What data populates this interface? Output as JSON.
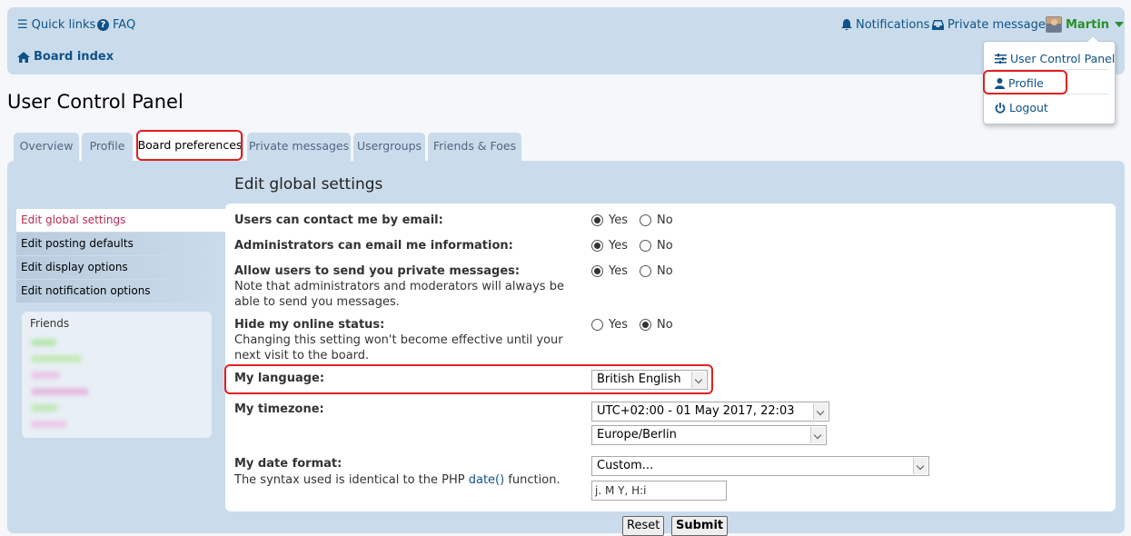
{
  "navbar": {
    "quick_links": "Quick links",
    "faq": "FAQ",
    "board_index": "Board index",
    "notifications": "Notifications",
    "private_messages": "Private messages",
    "username": "Martin"
  },
  "user_menu": {
    "items": [
      {
        "label": "User Control Panel",
        "icon": "sliders-icon"
      },
      {
        "label": "Profile",
        "icon": "user-icon"
      },
      {
        "label": "Logout",
        "icon": "power-icon"
      }
    ]
  },
  "page": {
    "title": "User Control Panel"
  },
  "tabs": [
    {
      "label": "Overview"
    },
    {
      "label": "Profile"
    },
    {
      "label": "Board preferences",
      "active": true
    },
    {
      "label": "Private messages"
    },
    {
      "label": "Usergroups"
    },
    {
      "label": "Friends & Foes"
    }
  ],
  "sidebar": {
    "items": [
      {
        "label": "Edit global settings",
        "active": true
      },
      {
        "label": "Edit posting defaults"
      },
      {
        "label": "Edit display options"
      },
      {
        "label": "Edit notification options"
      }
    ],
    "friends_title": "Friends"
  },
  "form": {
    "section_title": "Edit global settings",
    "yes": "Yes",
    "no": "No",
    "contact_email": {
      "label": "Users can contact me by email:",
      "value": "Yes"
    },
    "admin_email": {
      "label": "Administrators can email me information:",
      "value": "Yes"
    },
    "allow_pm": {
      "label": "Allow users to send you private messages:",
      "description": "Note that administrators and moderators will always be able to send you messages.",
      "value": "Yes"
    },
    "hide_online": {
      "label": "Hide my online status:",
      "description": "Changing this setting won't become effective until your next visit to the board.",
      "value": "No"
    },
    "language": {
      "label": "My language:",
      "value": "British English"
    },
    "timezone": {
      "label": "My timezone:",
      "offset_value": "UTC+02:00 - 01 May 2017, 22:03",
      "zone_value": "Europe/Berlin"
    },
    "date_format": {
      "label": "My date format:",
      "description_before": "The syntax used is identical to the PHP ",
      "description_link": "date()",
      "description_after": " function.",
      "select_value": "Custom...",
      "custom_value": "j. M Y, H:i"
    },
    "reset_label": "Reset",
    "submit_label": "Submit"
  },
  "colors": {
    "nav_bg": "#cadceb",
    "link": "#105289",
    "active_item": "#bc2a4d",
    "username": "#2a8f2a",
    "highlight": "#e02020"
  }
}
